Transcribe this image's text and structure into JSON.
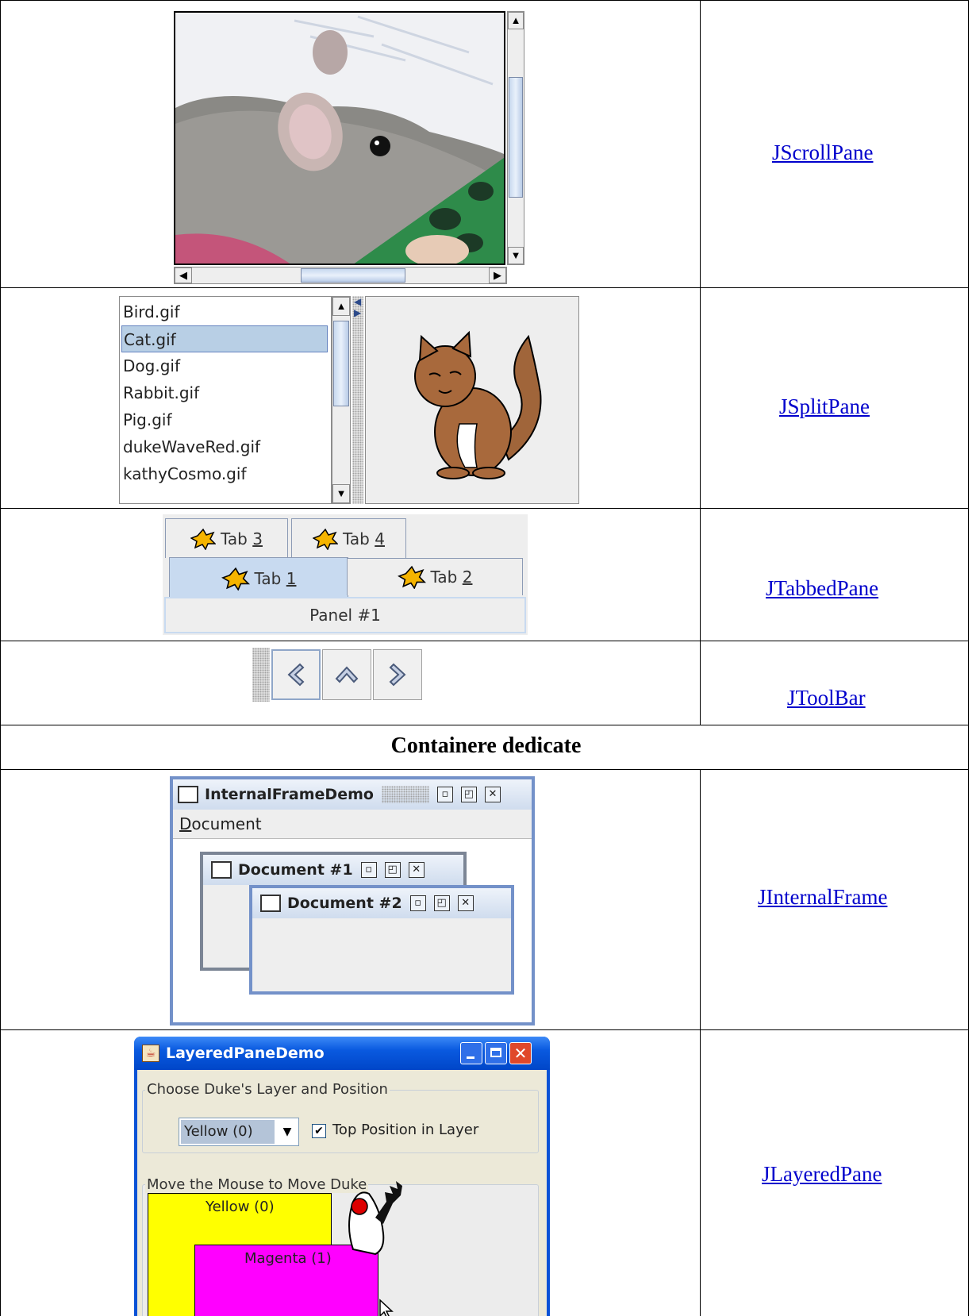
{
  "rows": [
    {
      "label": "JScrollPane"
    },
    {
      "label": "JSplitPane"
    },
    {
      "label": "JTabbedPane"
    },
    {
      "label": "JToolBar"
    },
    {
      "label": "JInternalFrame"
    },
    {
      "label": "JLayeredPane"
    }
  ],
  "section_heading": "Containere dedicate",
  "split_list": {
    "items": [
      "Bird.gif",
      "Cat.gif",
      "Dog.gif",
      "Rabbit.gif",
      "Pig.gif",
      "dukeWaveRed.gif",
      "kathyCosmo.gif"
    ],
    "selected": "Cat.gif"
  },
  "tabs": {
    "back_row": [
      {
        "text": "Tab ",
        "mn": "3"
      },
      {
        "text": "Tab ",
        "mn": "4"
      }
    ],
    "front_row": [
      {
        "text": "Tab ",
        "mn": "1"
      },
      {
        "text": "Tab ",
        "mn": "2"
      }
    ],
    "panel_label": "Panel #1"
  },
  "internal_frame": {
    "title": "InternalFrameDemo",
    "menu_first": "D",
    "menu_rest": "ocument",
    "doc1": "Document #1",
    "doc2": "Document #2"
  },
  "layered": {
    "title": "LayeredPaneDemo",
    "group1_legend": "Choose Duke's Layer and Position",
    "combo_value": "Yellow (0)",
    "checkbox_label": "Top Position in Layer",
    "checkbox_checked": true,
    "group2_legend": "Move the Mouse to Move Duke",
    "yellow_label": "Yellow (0)",
    "magenta_label": "Magenta (1)"
  }
}
